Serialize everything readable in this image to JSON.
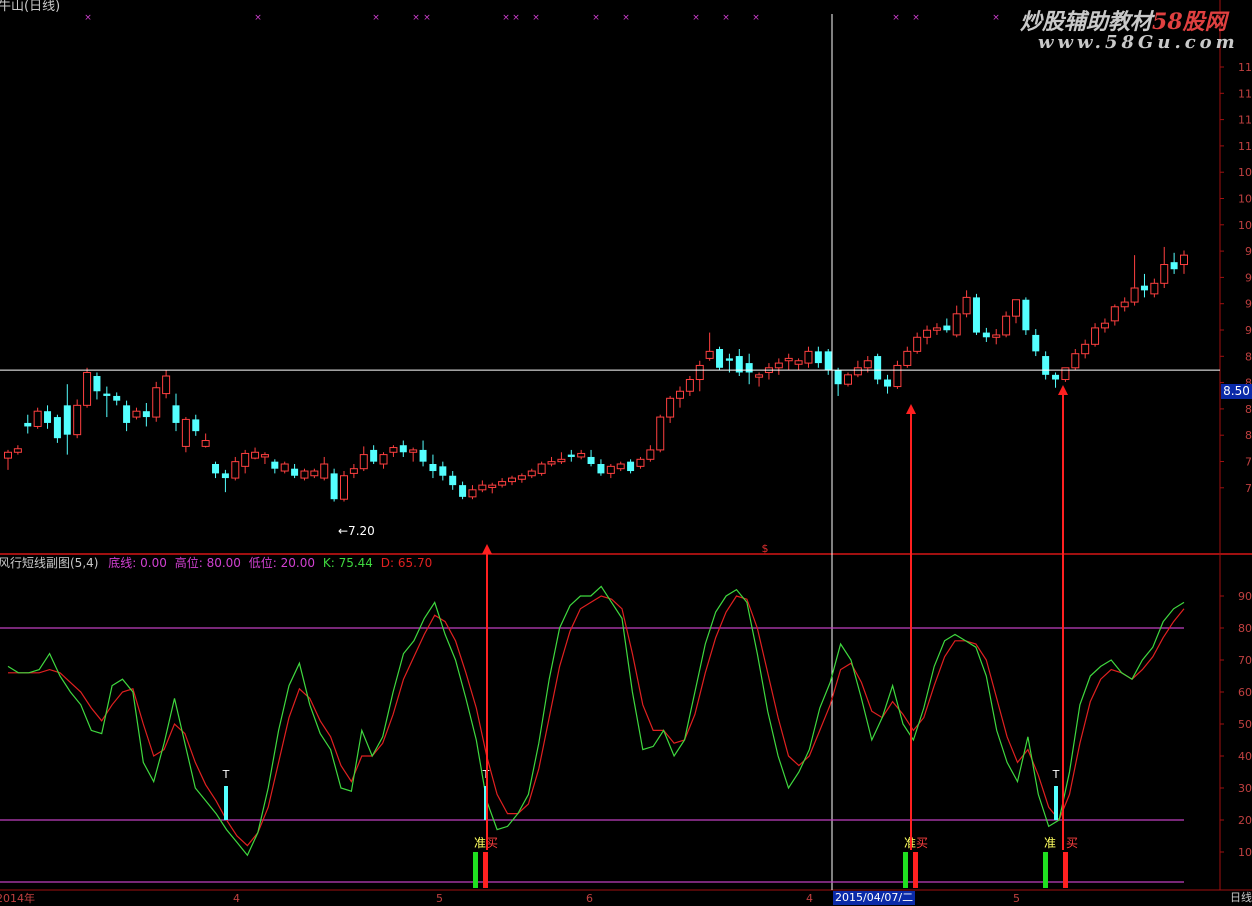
{
  "main_panel": {
    "title": "牛山(日线)",
    "low_marker_label": "←7.20",
    "crosshair_price": "8.50",
    "right_axis_labels": [
      "11",
      "11",
      "11",
      "11",
      "10",
      "10",
      "10",
      "9",
      "9",
      "9",
      "9",
      "8",
      "8",
      "8",
      "8",
      "7",
      "7"
    ],
    "signal_marker": "×"
  },
  "sub_panel": {
    "indicator_title": "风行短线副图(5,4)",
    "legend": [
      {
        "label": "底线:",
        "value": "0.00"
      },
      {
        "label": "高位:",
        "value": "80.00"
      },
      {
        "label": "低位:",
        "value": "20.00"
      },
      {
        "label": "K:",
        "value": "75.44"
      },
      {
        "label": "D:",
        "value": "65.70"
      }
    ],
    "right_axis_labels": [
      "90",
      "80",
      "70",
      "60",
      "50",
      "40",
      "30",
      "20",
      "10"
    ],
    "top_symbol": "$",
    "t_marker": "T",
    "prep_label": "准",
    "buy_label": "买"
  },
  "time_axis": {
    "labels": [
      "2014年",
      "4",
      "5",
      "6",
      "4",
      "2015/04/07/二",
      "5"
    ],
    "corner_label": "日线"
  },
  "watermark": {
    "line1_prefix": "炒股辅助教材",
    "line1_highlight": "58股网",
    "line2": "www.58Gu.com"
  },
  "colors": {
    "up_candle": "#ff4040",
    "down_candle": "#54ffff",
    "k_line": "#3fd83f",
    "d_line": "#e02020",
    "guide": "#c040c0",
    "axis": "#a01010",
    "buy": "#ff2020",
    "prep": "#20e020",
    "legend_label": "#d040d0",
    "crosshair": "#ffffff"
  },
  "chart_data": {
    "type": "candlestick",
    "title": "牛山(日线)",
    "ohlc": [
      [
        7.75,
        7.82,
        7.65,
        7.8
      ],
      [
        7.8,
        7.86,
        7.78,
        7.83
      ],
      [
        8.05,
        8.12,
        7.96,
        8.02
      ],
      [
        8.02,
        8.18,
        8.0,
        8.15
      ],
      [
        8.15,
        8.2,
        8.0,
        8.05
      ],
      [
        8.1,
        8.12,
        7.88,
        7.92
      ],
      [
        8.2,
        8.38,
        7.78,
        7.95
      ],
      [
        7.95,
        8.25,
        7.92,
        8.2
      ],
      [
        8.2,
        8.52,
        8.18,
        8.48
      ],
      [
        8.45,
        8.48,
        8.25,
        8.32
      ],
      [
        8.3,
        8.36,
        8.1,
        8.28
      ],
      [
        8.28,
        8.31,
        8.2,
        8.24
      ],
      [
        8.2,
        8.24,
        7.98,
        8.05
      ],
      [
        8.1,
        8.18,
        8.08,
        8.15
      ],
      [
        8.15,
        8.22,
        8.02,
        8.1
      ],
      [
        8.1,
        8.4,
        8.06,
        8.35
      ],
      [
        8.3,
        8.5,
        8.26,
        8.45
      ],
      [
        8.2,
        8.3,
        7.98,
        8.05
      ],
      [
        7.85,
        8.1,
        7.8,
        8.08
      ],
      [
        8.08,
        8.12,
        7.94,
        7.98
      ],
      [
        7.85,
        7.96,
        7.84,
        7.9
      ],
      [
        7.7,
        7.72,
        7.58,
        7.62
      ],
      [
        7.62,
        7.65,
        7.46,
        7.58
      ],
      [
        7.58,
        7.76,
        7.56,
        7.72
      ],
      [
        7.68,
        7.82,
        7.62,
        7.79
      ],
      [
        7.75,
        7.84,
        7.74,
        7.8
      ],
      [
        7.76,
        7.8,
        7.7,
        7.78
      ],
      [
        7.72,
        7.74,
        7.62,
        7.66
      ],
      [
        7.64,
        7.72,
        7.62,
        7.7
      ],
      [
        7.66,
        7.7,
        7.58,
        7.6
      ],
      [
        7.58,
        7.66,
        7.56,
        7.64
      ],
      [
        7.6,
        7.66,
        7.58,
        7.64
      ],
      [
        7.58,
        7.76,
        7.56,
        7.7
      ],
      [
        7.62,
        7.66,
        7.38,
        7.4
      ],
      [
        7.4,
        7.64,
        7.38,
        7.6
      ],
      [
        7.62,
        7.7,
        7.58,
        7.66
      ],
      [
        7.66,
        7.85,
        7.64,
        7.78
      ],
      [
        7.82,
        7.86,
        7.7,
        7.72
      ],
      [
        7.7,
        7.8,
        7.66,
        7.78
      ],
      [
        7.8,
        7.86,
        7.76,
        7.84
      ],
      [
        7.86,
        7.9,
        7.76,
        7.8
      ],
      [
        7.8,
        7.84,
        7.72,
        7.82
      ],
      [
        7.82,
        7.9,
        7.68,
        7.72
      ],
      [
        7.7,
        7.78,
        7.58,
        7.64
      ],
      [
        7.68,
        7.72,
        7.56,
        7.6
      ],
      [
        7.6,
        7.64,
        7.48,
        7.52
      ],
      [
        7.52,
        7.55,
        7.4,
        7.42
      ],
      [
        7.42,
        7.52,
        7.4,
        7.48
      ],
      [
        7.48,
        7.56,
        7.46,
        7.52
      ],
      [
        7.5,
        7.54,
        7.45,
        7.52
      ],
      [
        7.52,
        7.58,
        7.5,
        7.55
      ],
      [
        7.55,
        7.6,
        7.52,
        7.58
      ],
      [
        7.57,
        7.62,
        7.54,
        7.6
      ],
      [
        7.6,
        7.66,
        7.58,
        7.64
      ],
      [
        7.62,
        7.72,
        7.6,
        7.7
      ],
      [
        7.7,
        7.76,
        7.68,
        7.72
      ],
      [
        7.72,
        7.8,
        7.7,
        7.74
      ],
      [
        7.78,
        7.82,
        7.72,
        7.76
      ],
      [
        7.76,
        7.82,
        7.74,
        7.79
      ],
      [
        7.76,
        7.82,
        7.68,
        7.7
      ],
      [
        7.7,
        7.74,
        7.6,
        7.62
      ],
      [
        7.62,
        7.7,
        7.58,
        7.68
      ],
      [
        7.66,
        7.72,
        7.64,
        7.7
      ],
      [
        7.72,
        7.74,
        7.62,
        7.64
      ],
      [
        7.68,
        7.76,
        7.66,
        7.74
      ],
      [
        7.74,
        7.86,
        7.72,
        7.82
      ],
      [
        7.82,
        8.12,
        7.8,
        8.1
      ],
      [
        8.1,
        8.28,
        8.05,
        8.26
      ],
      [
        8.26,
        8.36,
        8.18,
        8.32
      ],
      [
        8.32,
        8.45,
        8.28,
        8.42
      ],
      [
        8.42,
        8.58,
        8.32,
        8.54
      ],
      [
        8.6,
        8.82,
        8.58,
        8.66
      ],
      [
        8.68,
        8.7,
        8.5,
        8.52
      ],
      [
        8.6,
        8.64,
        8.48,
        8.58
      ],
      [
        8.62,
        8.68,
        8.45,
        8.48
      ],
      [
        8.56,
        8.64,
        8.38,
        8.48
      ],
      [
        8.44,
        8.48,
        8.36,
        8.46
      ],
      [
        8.48,
        8.56,
        8.42,
        8.52
      ],
      [
        8.52,
        8.6,
        8.46,
        8.56
      ],
      [
        8.58,
        8.64,
        8.5,
        8.6
      ],
      [
        8.55,
        8.6,
        8.5,
        8.58
      ],
      [
        8.56,
        8.7,
        8.52,
        8.66
      ],
      [
        8.66,
        8.7,
        8.52,
        8.56
      ],
      [
        8.66,
        8.68,
        8.46,
        8.5
      ],
      [
        8.5,
        8.52,
        8.28,
        8.38
      ],
      [
        8.38,
        8.48,
        8.36,
        8.46
      ],
      [
        8.46,
        8.58,
        8.44,
        8.52
      ],
      [
        8.52,
        8.62,
        8.48,
        8.58
      ],
      [
        8.62,
        8.64,
        8.38,
        8.42
      ],
      [
        8.42,
        8.46,
        8.3,
        8.36
      ],
      [
        8.36,
        8.58,
        8.34,
        8.54
      ],
      [
        8.54,
        8.7,
        8.52,
        8.66
      ],
      [
        8.66,
        8.82,
        8.64,
        8.78
      ],
      [
        8.78,
        8.88,
        8.72,
        8.84
      ],
      [
        8.84,
        8.9,
        8.8,
        8.86
      ],
      [
        8.88,
        8.94,
        8.82,
        8.84
      ],
      [
        8.8,
        9.05,
        8.78,
        8.98
      ],
      [
        8.98,
        9.18,
        8.95,
        9.12
      ],
      [
        9.12,
        9.15,
        8.8,
        8.82
      ],
      [
        8.82,
        8.86,
        8.74,
        8.78
      ],
      [
        8.78,
        8.85,
        8.72,
        8.8
      ],
      [
        8.8,
        9.0,
        8.78,
        8.96
      ],
      [
        8.96,
        9.1,
        8.9,
        9.1
      ],
      [
        9.1,
        9.12,
        8.8,
        8.84
      ],
      [
        8.8,
        8.85,
        8.62,
        8.66
      ],
      [
        8.62,
        8.66,
        8.42,
        8.46
      ],
      [
        8.46,
        8.48,
        8.35,
        8.42
      ],
      [
        8.42,
        8.52,
        8.4,
        8.52
      ],
      [
        8.52,
        8.68,
        8.5,
        8.64
      ],
      [
        8.64,
        8.76,
        8.6,
        8.72
      ],
      [
        8.72,
        8.9,
        8.7,
        8.86
      ],
      [
        8.86,
        8.94,
        8.82,
        8.9
      ],
      [
        8.92,
        9.06,
        8.88,
        9.04
      ],
      [
        9.04,
        9.12,
        9.0,
        9.08
      ],
      [
        9.08,
        9.48,
        9.05,
        9.2
      ],
      [
        9.22,
        9.32,
        9.12,
        9.18
      ],
      [
        9.15,
        9.28,
        9.12,
        9.24
      ],
      [
        9.24,
        9.55,
        9.2,
        9.4
      ],
      [
        9.42,
        9.5,
        9.32,
        9.36
      ],
      [
        9.4,
        9.52,
        9.32,
        9.48
      ]
    ],
    "price_levels": {
      "low_marker": 7.2,
      "crosshair": 8.5
    },
    "indicator": {
      "name": "风行短线副图(5,4)",
      "K_last": 75.44,
      "D_last": 65.7,
      "K_sample": [
        68,
        66,
        66,
        67,
        72,
        65,
        60,
        56,
        48,
        47,
        62,
        64,
        60,
        38,
        32,
        44,
        58,
        44,
        30,
        26,
        22,
        17,
        13,
        9,
        16,
        30,
        48,
        62,
        69,
        56,
        47,
        42,
        30,
        29,
        48,
        40,
        46,
        60,
        72,
        76,
        83,
        88,
        78,
        70,
        58,
        45,
        26,
        17,
        18,
        22,
        28,
        44,
        64,
        80,
        87,
        90,
        90,
        93,
        88,
        83,
        60,
        42,
        43,
        48,
        40,
        45,
        60,
        75,
        85,
        90,
        92,
        88,
        72,
        54,
        40,
        30,
        35,
        42,
        55,
        63,
        75,
        70,
        58,
        45,
        52,
        62,
        50,
        45,
        55,
        68,
        76,
        78,
        76,
        74,
        65,
        48,
        38,
        32,
        46,
        28,
        18,
        20,
        35,
        56,
        65,
        68,
        70,
        66,
        64,
        70,
        74,
        82,
        86,
        88
      ],
      "D_sample": [
        66,
        66,
        66,
        66,
        67,
        66,
        63,
        60,
        55,
        51,
        56,
        60,
        61,
        50,
        40,
        42,
        50,
        47,
        38,
        31,
        26,
        20,
        15,
        12,
        16,
        24,
        38,
        52,
        61,
        58,
        51,
        46,
        37,
        32,
        40,
        40,
        44,
        53,
        64,
        71,
        78,
        84,
        82,
        76,
        66,
        55,
        40,
        28,
        22,
        22,
        25,
        36,
        52,
        68,
        79,
        86,
        88,
        90,
        89,
        86,
        72,
        56,
        48,
        48,
        44,
        45,
        53,
        66,
        77,
        85,
        90,
        89,
        80,
        66,
        52,
        40,
        37,
        40,
        48,
        56,
        67,
        69,
        63,
        54,
        52,
        57,
        53,
        48,
        52,
        62,
        71,
        76,
        76,
        75,
        70,
        58,
        46,
        38,
        42,
        34,
        24,
        20,
        28,
        44,
        57,
        64,
        67,
        66,
        64,
        67,
        71,
        77,
        82,
        86
      ]
    },
    "guides": {
      "high": 80,
      "low": 20,
      "base": 0
    }
  }
}
